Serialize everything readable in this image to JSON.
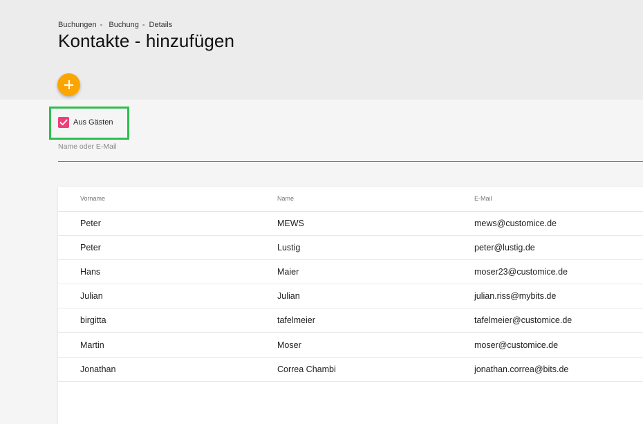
{
  "breadcrumb": {
    "items": [
      "Buchungen",
      "Buchung",
      "Details"
    ],
    "separator": "-"
  },
  "page": {
    "title": "Kontakte - hinzufügen"
  },
  "fab": {
    "icon": "plus-icon",
    "color": "#fba600"
  },
  "filter": {
    "checkbox_label": "Aus Gästen",
    "checked": true,
    "checkbox_color": "#ee3f7a",
    "highlight_color": "#2ebf4f"
  },
  "search": {
    "placeholder": "Name oder E-Mail",
    "value": ""
  },
  "table": {
    "columns": [
      "Vorname",
      "Name",
      "E-Mail"
    ],
    "rows": [
      [
        "Peter",
        "MEWS",
        "mews@customice.de"
      ],
      [
        "Peter",
        "Lustig",
        "peter@lustig.de"
      ],
      [
        "Hans",
        "Maier",
        "moser23@customice.de"
      ],
      [
        "Julian",
        "Julian",
        "julian.riss@mybits.de"
      ],
      [
        "birgitta",
        "tafelmeier",
        "tafelmeier@customice.de"
      ],
      [
        "Martin",
        "Moser",
        "moser@customice.de"
      ],
      [
        "Jonathan",
        "Correa Chambi",
        "jonathan.correa@bits.de"
      ]
    ]
  }
}
